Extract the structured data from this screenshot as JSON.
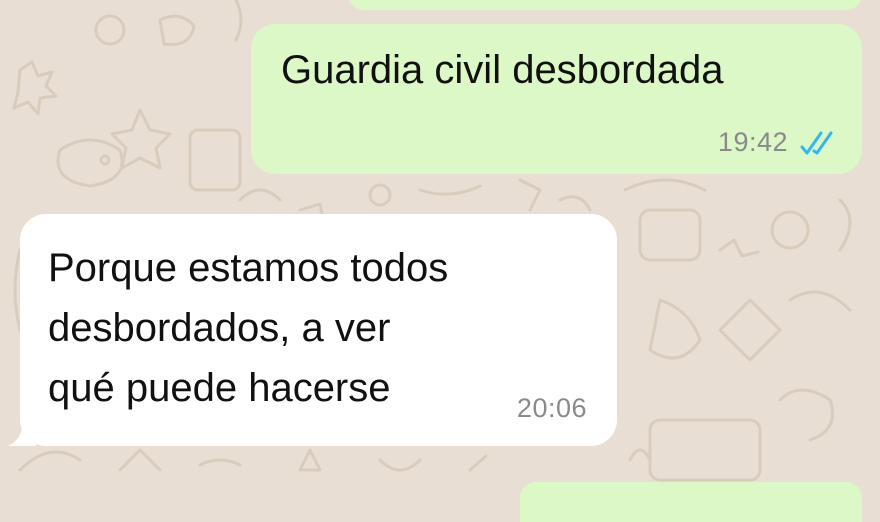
{
  "conversation": {
    "messages": [
      {
        "direction": "outgoing",
        "text": "Guardia civil desbordada",
        "time": "19:42",
        "status_icon": "double-check-read-icon"
      },
      {
        "direction": "incoming",
        "text": "Porque estamos todos desbordados, a ver qué puede hacerse",
        "time": "20:06"
      }
    ]
  },
  "colors": {
    "wallpaper": "#e8ded4",
    "outgoing_bubble": "#dcf8c6",
    "incoming_bubble": "#ffffff",
    "read_ticks": "#34b7f1",
    "timestamp": "#8a8a8a"
  }
}
